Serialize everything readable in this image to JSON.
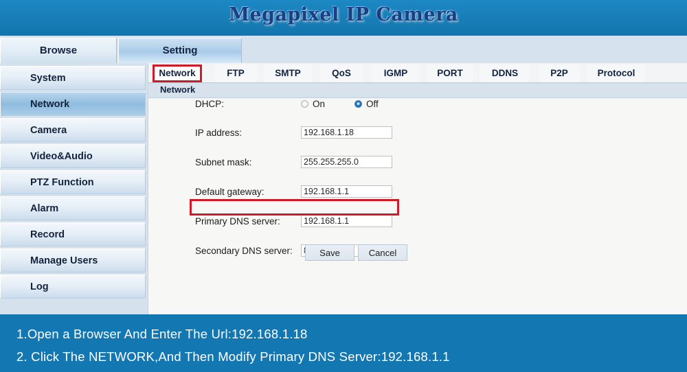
{
  "header": {
    "title": "Megapixel IP Camera"
  },
  "toptabs": [
    {
      "label": "Browse",
      "active": false
    },
    {
      "label": "Setting",
      "active": true
    }
  ],
  "sidebar": {
    "items": [
      {
        "label": "System"
      },
      {
        "label": "Network"
      },
      {
        "label": "Camera"
      },
      {
        "label": "Video&Audio"
      },
      {
        "label": "PTZ Function"
      },
      {
        "label": "Alarm"
      },
      {
        "label": "Record"
      },
      {
        "label": "Manage Users"
      },
      {
        "label": "Log"
      }
    ],
    "active_index": 1
  },
  "subtabs": [
    {
      "label": "Network"
    },
    {
      "label": "FTP"
    },
    {
      "label": "SMTP"
    },
    {
      "label": "QoS"
    },
    {
      "label": "IGMP"
    },
    {
      "label": "PORT"
    },
    {
      "label": "DDNS"
    },
    {
      "label": "P2P"
    },
    {
      "label": "Protocol"
    }
  ],
  "section": {
    "title": "Network"
  },
  "form": {
    "dhcp": {
      "label": "DHCP:",
      "on_label": "On",
      "off_label": "Off",
      "selected": "Off"
    },
    "fields": [
      {
        "label": "IP address:",
        "value": "192.168.1.18"
      },
      {
        "label": "Subnet mask:",
        "value": "255.255.255.0"
      },
      {
        "label": "Default gateway:",
        "value": "192.168.1.1"
      },
      {
        "label": "Primary DNS server:",
        "value": "192.168.1.1"
      },
      {
        "label": "Secondary DNS server:",
        "value": "8.8.8.8"
      }
    ],
    "save_label": "Save",
    "cancel_label": "Cancel"
  },
  "caption": {
    "line1": "1.Open a Browser And Enter The Url:192.168.1.18",
    "line2": "2. Click The NETWORK,And Then Modify Primary DNS Server:192.168.1.1"
  },
  "colors": {
    "header_blue": "#1a7fb9",
    "banner_blue": "#1377b1",
    "highlight_red": "#cf1b28",
    "sidebar_bg": "#d5e2ee",
    "content_bg": "#f7f7f5",
    "accent_text": "#1c3f84"
  }
}
